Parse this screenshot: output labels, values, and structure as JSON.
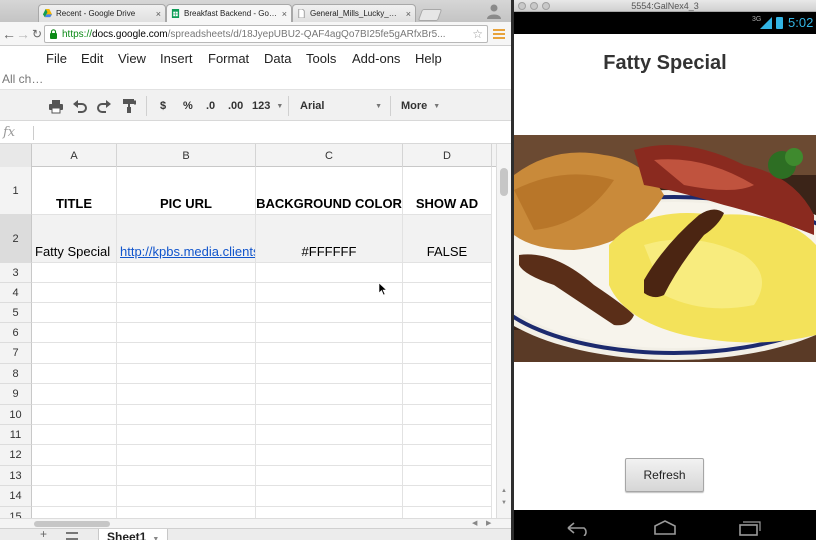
{
  "browser": {
    "tabs": [
      {
        "label": "Recent - Google Drive",
        "close": "×"
      },
      {
        "label": "Breakfast Backend - Googl",
        "close": "×"
      },
      {
        "label": "General_Mills_Lucky_Charm",
        "close": "×"
      }
    ],
    "url": {
      "scheme": "https://",
      "domain": "docs.google.com",
      "path": "/spreadsheets/d/18JyepUBU2-QAF4agQo7BI25fe5gARfxBr5..."
    }
  },
  "sheets": {
    "menu": [
      "File",
      "Edit",
      "View",
      "Insert",
      "Format",
      "Data",
      "Tools",
      "Add-ons",
      "Help"
    ],
    "save_status": "All ch…",
    "toolbar": {
      "currency": "$",
      "percent": "%",
      "dec_decrease": ".0",
      "dec_increase": ".00",
      "number_format": "123",
      "font": "Arial",
      "more": "More"
    },
    "fx_label": "fx",
    "columns": [
      "A",
      "B",
      "C",
      "D"
    ],
    "rows": [
      {
        "num": "1",
        "cells": [
          "TITLE",
          "PIC URL",
          "BACKGROUND COLOR",
          "SHOW AD"
        ]
      },
      {
        "num": "2",
        "cells": [
          "Fatty Special",
          "http://kpbs.media.clients.",
          "#FFFFFF",
          "FALSE"
        ]
      },
      {
        "num": "3",
        "cells": [
          "",
          "",
          "",
          ""
        ]
      },
      {
        "num": "4",
        "cells": [
          "",
          "",
          "",
          ""
        ]
      },
      {
        "num": "5",
        "cells": [
          "",
          "",
          "",
          ""
        ]
      },
      {
        "num": "6",
        "cells": [
          "",
          "",
          "",
          ""
        ]
      },
      {
        "num": "7",
        "cells": [
          "",
          "",
          "",
          ""
        ]
      },
      {
        "num": "8",
        "cells": [
          "",
          "",
          "",
          ""
        ]
      },
      {
        "num": "9",
        "cells": [
          "",
          "",
          "",
          ""
        ]
      },
      {
        "num": "10",
        "cells": [
          "",
          "",
          "",
          ""
        ]
      },
      {
        "num": "11",
        "cells": [
          "",
          "",
          "",
          ""
        ]
      },
      {
        "num": "12",
        "cells": [
          "",
          "",
          "",
          ""
        ]
      },
      {
        "num": "13",
        "cells": [
          "",
          "",
          "",
          ""
        ]
      },
      {
        "num": "14",
        "cells": [
          "",
          "",
          "",
          ""
        ]
      },
      {
        "num": "15",
        "cells": [
          "",
          "",
          "",
          ""
        ]
      }
    ],
    "sheet_tab": "Sheet1"
  },
  "emulator": {
    "window_title": "5554:GalNex4_3",
    "network": "3G",
    "clock": "5:02",
    "app_title": "Fatty Special",
    "refresh_label": "Refresh",
    "accent": "#33b5e5"
  }
}
